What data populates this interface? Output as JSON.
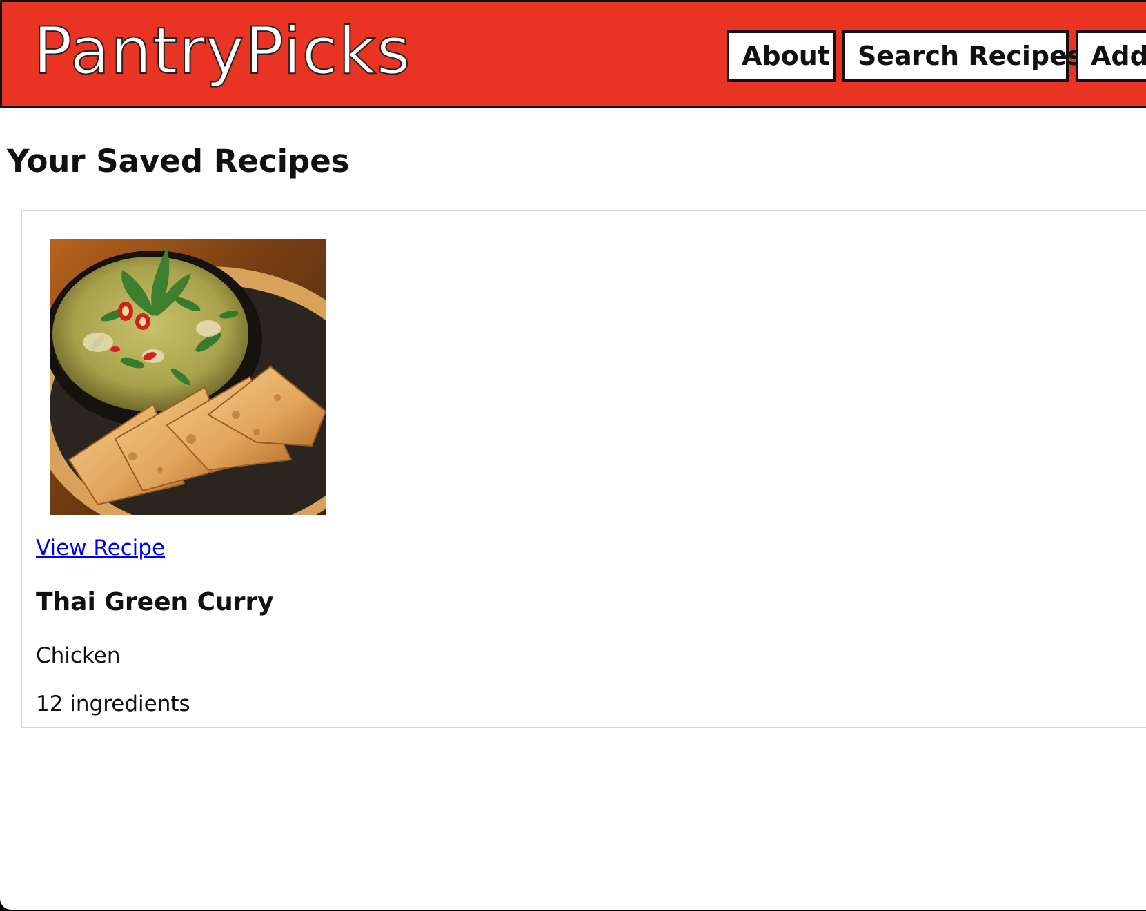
{
  "header": {
    "logo": "PantryPicks",
    "nav": {
      "about": "About",
      "search": "Search Recipes",
      "add": "Add"
    }
  },
  "main": {
    "heading": "Your Saved Recipes",
    "recipes": [
      {
        "image": "thai-green-curry-photo",
        "link_label": "View Recipe",
        "title": "Thai Green Curry",
        "protein": "Chicken",
        "ingredients": "12 ingredients"
      }
    ]
  },
  "colors": {
    "header_background": "#e93323",
    "link": "#0000ee",
    "card_border": "#d6d6d6"
  }
}
